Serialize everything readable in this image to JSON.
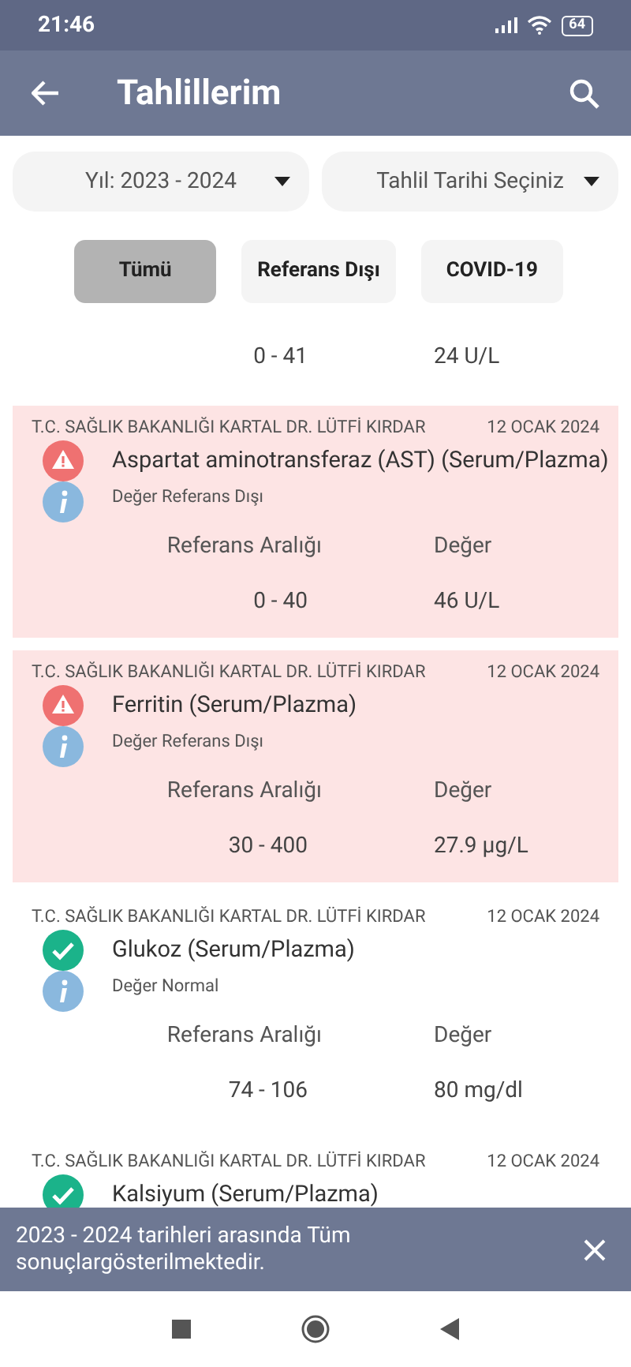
{
  "status_bar": {
    "time": "21:46",
    "battery": "64"
  },
  "app_bar": {
    "title": "Tahlillerim"
  },
  "filters": [
    {
      "value": "Yıl: 2023 - 2024"
    },
    {
      "value": "Tahlil Tarihi Seçiniz"
    }
  ],
  "chips": [
    {
      "label": "Tümü",
      "selected": true
    },
    {
      "label": "Referans Dışı",
      "selected": false
    },
    {
      "label": "COVID-19",
      "selected": false
    }
  ],
  "results": [
    {
      "out_of_range": false,
      "range": "0 - 41",
      "value": "24 U/L"
    },
    {
      "out_of_range": true,
      "hospital": "T.C. SAĞLIK BAKANLIĞI KARTAL DR. LÜTFİ KIRDAR",
      "date": "12 OCAK 2024",
      "title": "Aspartat aminotransferaz (AST) (Serum/Plazma)",
      "note": "Değer Referans Dışı",
      "range_label": "Referans Aralığı",
      "value_label": "Değer",
      "range": "0 - 40",
      "value": "46 U/L"
    },
    {
      "out_of_range": true,
      "hospital": "T.C. SAĞLIK BAKANLIĞI KARTAL DR. LÜTFİ KIRDAR",
      "date": "12 OCAK 2024",
      "title": "Ferritin (Serum/Plazma)",
      "note": "Değer Referans Dışı",
      "range_label": "Referans Aralığı",
      "value_label": "Değer",
      "range": "30 - 400",
      "value": "27.9 µg/L"
    },
    {
      "out_of_range": false,
      "hospital": "T.C. SAĞLIK BAKANLIĞI KARTAL DR. LÜTFİ KIRDAR",
      "date": "12 OCAK 2024",
      "title": "Glukoz (Serum/Plazma)",
      "note": "Değer Normal",
      "range_label": "Referans Aralığı",
      "value_label": "Değer",
      "range": "74 - 106",
      "value": "80 mg/dl"
    },
    {
      "out_of_range": false,
      "hospital": "T.C. SAĞLIK BAKANLIĞI KARTAL DR. LÜTFİ KIRDAR",
      "date": "12 OCAK 2024",
      "title": "Kalsiyum (Serum/Plazma)"
    }
  ],
  "snackbar": {
    "message": "2023 - 2024 tarihleri arasında Tüm sonuçlargösterilmektedir."
  }
}
